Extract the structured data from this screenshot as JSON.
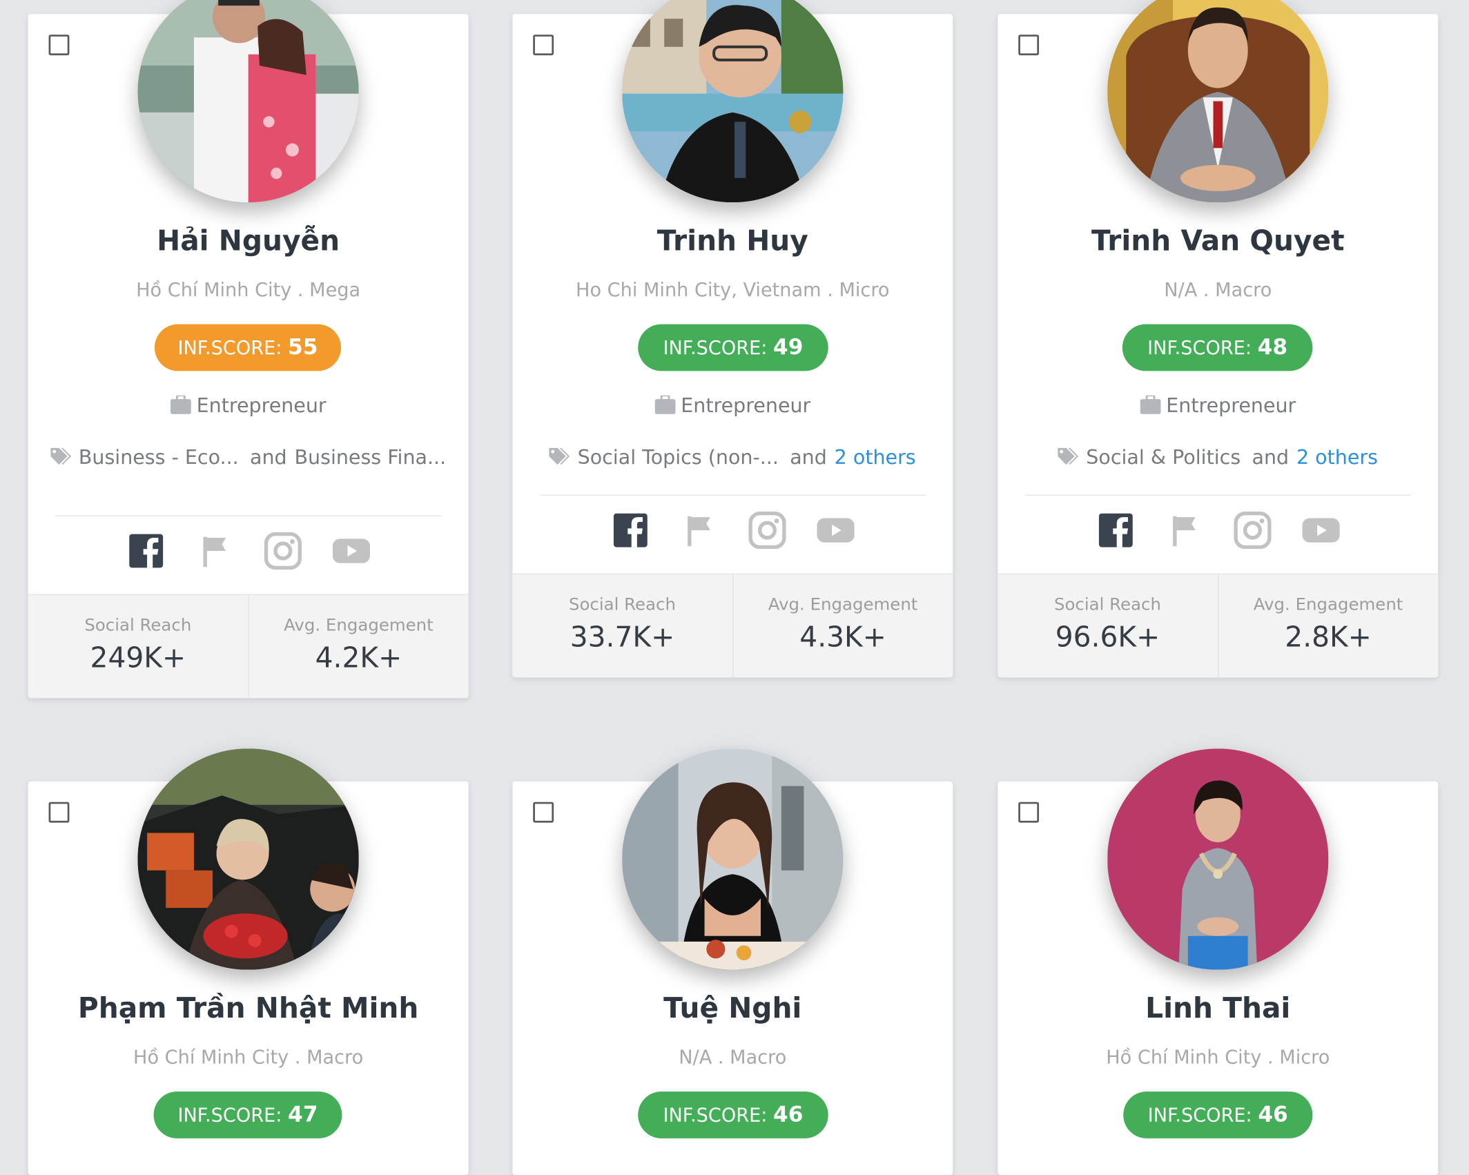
{
  "colors": {
    "page_bg": "#e4e6ea",
    "score_orange": "#f39a2c",
    "score_green": "#43ad57",
    "link_blue": "#2b8fd9",
    "facebook_dark": "#3a4350",
    "icon_gray": "#c2c2c2"
  },
  "score_prefix": "INF.SCORE:",
  "stats_labels": {
    "reach": "Social Reach",
    "engagement": "Avg. Engagement"
  },
  "and_text": "and",
  "icons": {
    "checkbox": "checkbox-icon",
    "category": "briefcase-icon",
    "tags": "tags-icon",
    "socials": [
      "facebook-icon",
      "flag-icon",
      "instagram-icon",
      "youtube-icon"
    ]
  },
  "cards": [
    {
      "name": "Hải Nguyễn",
      "location": "Hồ Chí Minh City . Mega",
      "score": "55",
      "score_color": "orange",
      "category": "Entrepreneur",
      "tag1": "Business - Eco...",
      "tag2": "Business Fina...",
      "others": "",
      "reach": "249K+",
      "engagement": "4.2K+"
    },
    {
      "name": "Trinh Huy",
      "location": "Ho Chi Minh City, Vietnam . Micro",
      "score": "49",
      "score_color": "green",
      "category": "Entrepreneur",
      "tag1": "Social Topics (non-...",
      "tag2": "",
      "others": "2 others",
      "reach": "33.7K+",
      "engagement": "4.3K+"
    },
    {
      "name": "Trinh Van Quyet",
      "location": "N/A . Macro",
      "score": "48",
      "score_color": "green",
      "category": "Entrepreneur",
      "tag1": "Social & Politics",
      "tag2": "",
      "others": "2 others",
      "reach": "96.6K+",
      "engagement": "2.8K+"
    },
    {
      "name": "Phạm Trần Nhật Minh",
      "location": "Hồ Chí Minh City . Macro",
      "score": "47",
      "score_color": "green"
    },
    {
      "name": "Tuệ Nghi",
      "location": "N/A . Macro",
      "score": "46",
      "score_color": "green"
    },
    {
      "name": "Linh Thai",
      "location": "Hồ Chí Minh City . Micro",
      "score": "46",
      "score_color": "green"
    }
  ]
}
